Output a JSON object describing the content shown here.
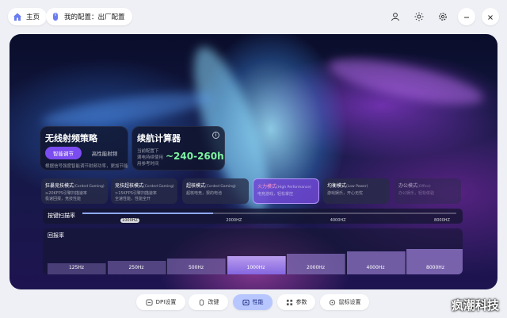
{
  "header": {
    "home_label": "主页",
    "config_label": "我的配置：出厂配置",
    "icons": [
      "home-icon",
      "mouse-icon",
      "user-icon",
      "brightness-icon",
      "settings-icon",
      "minimize-icon",
      "close-icon"
    ]
  },
  "wireless_card": {
    "title": "无线射频策略",
    "option_smart": "智能调节",
    "option_high": "高性能射频",
    "description": "根据信号强度智能调节射频功率，更加节能"
  },
  "battery_card": {
    "title": "续航计算器",
    "desc_line1": "当前配置下",
    "desc_line2": "满电持续使用",
    "desc_line3": "用参考时间",
    "value": "~240-260h"
  },
  "modes": [
    {
      "title": "狂暴竞技模式",
      "sub": "(Corded Gaming)",
      "desc1": "≥20KFPS引擎扫描速率",
      "desc2": "极速回报，竞技性能",
      "state": "normal"
    },
    {
      "title": "竞技超核模式",
      "sub": "(Corded Gaming)",
      "desc1": ">15KFPS引擎扫描速率",
      "desc2": "全速性能，性能全开",
      "state": "normal"
    },
    {
      "title": "超核模式",
      "sub": "(Corded Gaming)",
      "desc1": "超核电竞，狠的电池",
      "desc2": "",
      "state": "normal"
    },
    {
      "title": "火力模式",
      "sub": "(High Performance)",
      "desc1": "电竞游戏，轻松掌控",
      "desc2": "",
      "state": "active"
    },
    {
      "title": "均衡模式",
      "sub": "(Low Power)",
      "desc1": "游戏娱乐，开心无忧",
      "desc2": "",
      "state": "normal"
    },
    {
      "title": "办公模式",
      "sub": "(Office)",
      "desc1": "办公娱乐，轻松体验",
      "desc2": "",
      "state": "dim"
    }
  ],
  "scan_rate": {
    "label": "按键扫描率",
    "options": [
      "1000HZ",
      "2000HZ",
      "4000HZ",
      "8000HZ"
    ],
    "selected": "1000HZ",
    "level": 0.35
  },
  "polling": {
    "label": "回报率",
    "options": [
      "125Hz",
      "250Hz",
      "500Hz",
      "1000Hz",
      "2000Hz",
      "4000Hz",
      "8000Hz"
    ],
    "selected": "1000Hz"
  },
  "tabs": [
    {
      "label": "DPI设置",
      "icon": "dpi-icon"
    },
    {
      "label": "改键",
      "icon": "mouse-icon"
    },
    {
      "label": "性能",
      "icon": "performance-icon"
    },
    {
      "label": "参数",
      "icon": "grid-icon"
    },
    {
      "label": "鼠标设置",
      "icon": "mouse-settings-icon"
    }
  ],
  "active_tab": "性能",
  "watermark": "疯潮科技",
  "colors": {
    "accent": "#7b4cf0",
    "tab_active": "#b8c6ff",
    "value_green": "#7cf3a0"
  }
}
